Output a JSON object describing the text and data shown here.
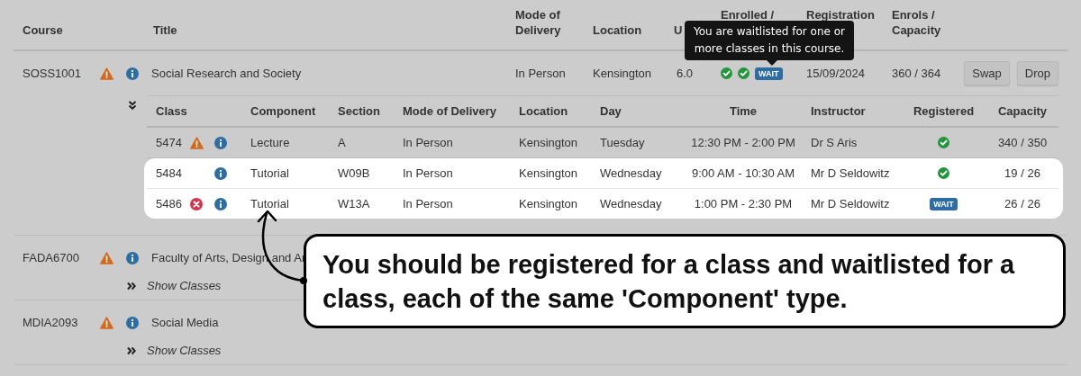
{
  "header": [
    {
      "label": "Course",
      "partly_hidden": false
    },
    {
      "label": "Title",
      "partly_hidden": false
    },
    {
      "label": "Mode of Delivery",
      "partly_hidden": false
    },
    {
      "label": "Location",
      "partly_hidden": false
    },
    {
      "label": "U",
      "partly_hidden": false
    },
    {
      "label": "Enrolled /",
      "partly_hidden": true
    },
    {
      "label": "Registration",
      "partly_hidden": true
    },
    {
      "label": "Enrols / Capacity",
      "partly_hidden": false
    }
  ],
  "courses": [
    {
      "code": "SOSS1001",
      "warning": true,
      "info": true,
      "title": "Social Research and Society",
      "mode": "In Person",
      "location": "Kensington",
      "uoc": "6.0",
      "statuses": [
        {
          "kind": "registered"
        },
        {
          "kind": "registered"
        },
        {
          "kind": "waitlisted",
          "label": "WAIT"
        }
      ],
      "closes": "15/09/2024",
      "enrols": "360 / 364",
      "actions": [
        "Swap",
        "Drop"
      ],
      "expanded": true,
      "classes": {
        "columns": [
          "Class",
          "Component",
          "Section",
          "Mode of Delivery",
          "Location",
          "Day",
          "Time",
          "Instructor",
          "Registered",
          "Capacity"
        ],
        "rows": [
          {
            "class": "5474",
            "warning": true,
            "error": false,
            "info": true,
            "component": "Lecture",
            "section": "A",
            "mode": "In Person",
            "location": "Kensington",
            "day": "Tuesday",
            "time": "12:30 PM - 2:00 PM",
            "instructor": "Dr S Aris",
            "registered": {
              "kind": "registered"
            },
            "capacity": "340 / 350",
            "highlighted": false
          },
          {
            "class": "5484",
            "warning": false,
            "error": false,
            "info": true,
            "component": "Tutorial",
            "section": "W09B",
            "mode": "In Person",
            "location": "Kensington",
            "day": "Wednesday",
            "time": "9:00 AM - 10:30 AM",
            "instructor": "Mr D Seldowitz",
            "registered": {
              "kind": "registered"
            },
            "capacity": "19 / 26",
            "highlighted": true
          },
          {
            "class": "5486",
            "warning": false,
            "error": true,
            "info": true,
            "component": "Tutorial",
            "section": "W13A",
            "mode": "In Person",
            "location": "Kensington",
            "day": "Wednesday",
            "time": "1:00 PM - 2:30 PM",
            "instructor": "Mr D Seldowitz",
            "registered": {
              "kind": "waitlisted",
              "label": "WAIT"
            },
            "capacity": "26 / 26",
            "highlighted": true
          }
        ]
      }
    },
    {
      "code": "FADA6700",
      "warning": true,
      "info": true,
      "title": "Faculty of Arts, Design and Ar",
      "expanded": false,
      "toggle": "Show Classes"
    },
    {
      "code": "MDIA2093",
      "warning": true,
      "info": true,
      "title": "Social Media",
      "expanded": false,
      "toggle": "Show Classes"
    }
  ],
  "tooltip": {
    "text": "You are waitlisted for one or more classes in this course."
  },
  "callout": {
    "text": "You should be registered for a class and waitlisted for a class, each of the same 'Component' type."
  }
}
